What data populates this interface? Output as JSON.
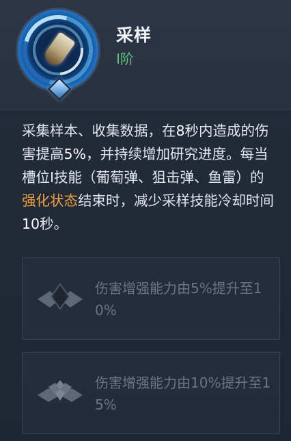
{
  "skill": {
    "name": "采样",
    "tier": "I阶",
    "icon": "sample-skill-icon"
  },
  "description": {
    "p1": "采集样本、收集数据，在",
    "n1": "8",
    "p2": "秒内造成的伤害提高",
    "n2": "5%",
    "p3": "，并持续增加研究进度。每当槽位I技能（葡萄弹、狙击弹、鱼雷）的",
    "highlight": "强化状态",
    "p4": "结束时，减少采样技能冷却时间",
    "n3": "10",
    "p5": "秒。"
  },
  "upgrades": [
    {
      "text": "伤害增强能力由5%提升至10%",
      "icon": "rank-badge-icon",
      "locked": true
    },
    {
      "text": "伤害增强能力由10%提升至15%",
      "icon": "rank-badge-icon",
      "locked": true
    }
  ],
  "colors": {
    "background": "#1f2734",
    "tier_green": "#5ec27a",
    "highlight_orange": "#f2a043",
    "locked_text": "#6b7585"
  }
}
